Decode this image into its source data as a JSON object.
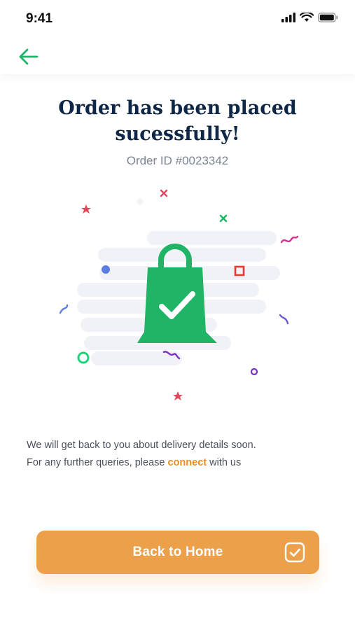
{
  "status_bar": {
    "time": "9:41",
    "icons": [
      "signal-icon",
      "wifi-icon",
      "battery-icon"
    ]
  },
  "header": {
    "back_icon": "arrow-left-icon"
  },
  "confirmation": {
    "title": "Order has been placed\nsucessfully!",
    "order_id": "Order ID #0023342",
    "illustration_icon": "shopping-bag-check-icon"
  },
  "message": {
    "line1": "We will get back to you about delivery details soon.",
    "line2_prefix": "For any further queries, please ",
    "link": "connect",
    "line2_suffix": " with us"
  },
  "cta": {
    "label": "Back to Home",
    "icon": "checkbox-check-icon"
  },
  "colors": {
    "accent_green": "#1fb466",
    "title_navy": "#0f2747",
    "button_orange": "#eda04a",
    "link_orange": "#f08c1e"
  }
}
